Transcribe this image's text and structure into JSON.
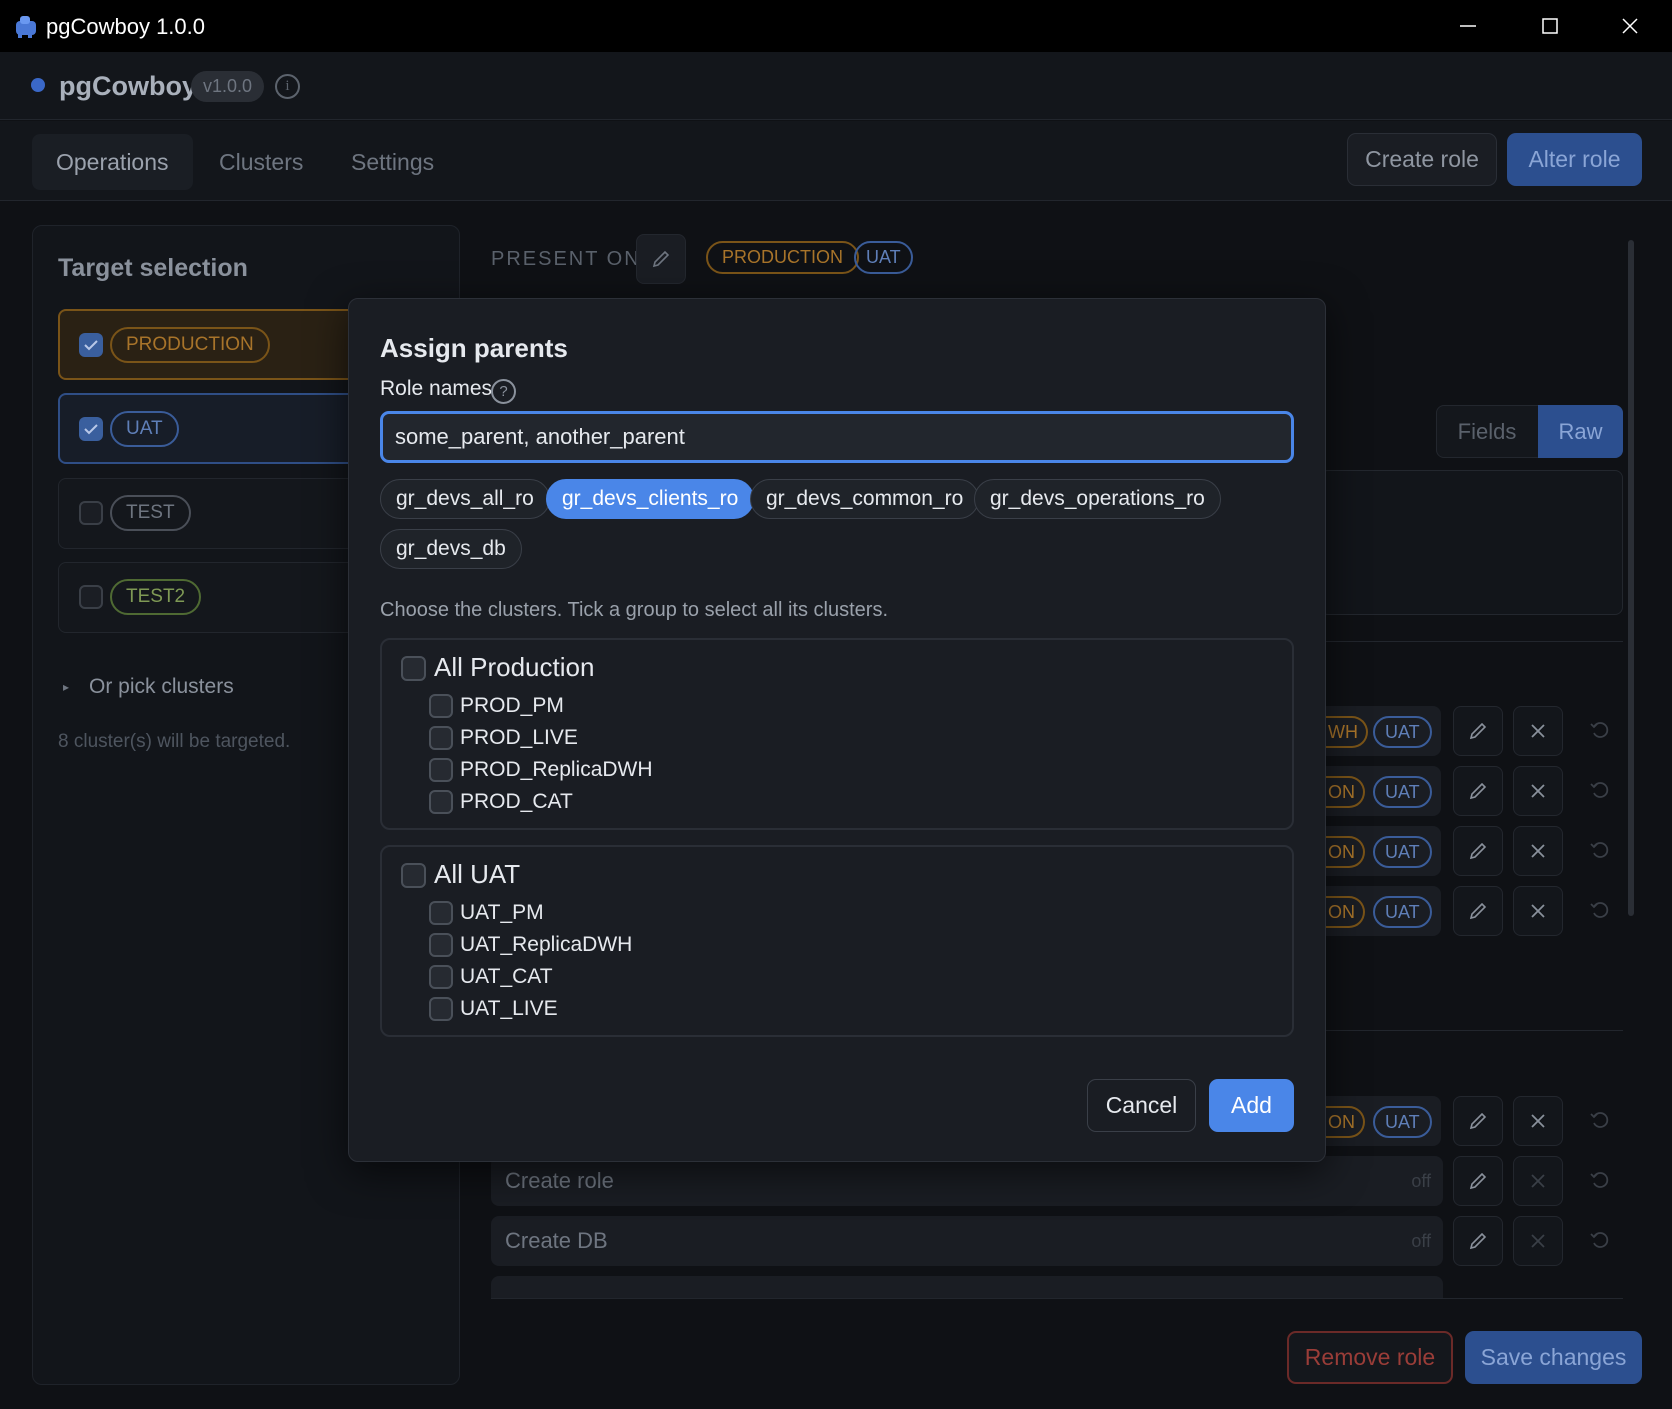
{
  "window": {
    "title": "pgCowboy 1.0.0"
  },
  "header": {
    "brand": "pgCowboy",
    "version": "v1.0.0"
  },
  "nav": {
    "tabs": [
      "Operations",
      "Clusters",
      "Settings"
    ],
    "create_role": "Create role",
    "alter_role": "Alter role"
  },
  "sidebar": {
    "title": "Target selection",
    "targets": [
      {
        "label": "PRODUCTION",
        "checked": true
      },
      {
        "label": "UAT",
        "checked": true
      },
      {
        "label": "TEST",
        "checked": false
      },
      {
        "label": "TEST2",
        "checked": false
      }
    ],
    "pick_clusters": "Or pick clusters",
    "summary": "8 cluster(s) will be targeted."
  },
  "main": {
    "present_on": "PRESENT ON",
    "badges": [
      "PRODUCTION",
      "UAT"
    ],
    "toggle": [
      "Fields",
      "Raw"
    ],
    "row_badges": [
      "WH",
      "UAT",
      "ON",
      "UAT",
      "ON",
      "UAT",
      "ON",
      "UAT",
      "ON",
      "UAT"
    ],
    "rows": [
      {
        "label": "Create role",
        "state": "off"
      },
      {
        "label": "Create DB",
        "state": "off"
      }
    ],
    "remove_role": "Remove role",
    "save_changes": "Save changes"
  },
  "modal": {
    "title": "Assign parents",
    "role_names_label": "Role names",
    "help_icon": "?",
    "input_value": "some_parent, another_parent",
    "suggestions": [
      {
        "label": "gr_devs_all_ro",
        "selected": false
      },
      {
        "label": "gr_devs_clients_ro",
        "selected": true
      },
      {
        "label": "gr_devs_common_ro",
        "selected": false
      },
      {
        "label": "gr_devs_operations_ro",
        "selected": false
      },
      {
        "label": "gr_devs_db",
        "selected": false
      }
    ],
    "hint": "Choose the clusters. Tick a group to select all its clusters.",
    "groups": [
      {
        "title": "All Production",
        "items": [
          "PROD_PM",
          "PROD_LIVE",
          "PROD_ReplicaDWH",
          "PROD_CAT"
        ]
      },
      {
        "title": "All UAT",
        "items": [
          "UAT_PM",
          "UAT_ReplicaDWH",
          "UAT_CAT",
          "UAT_LIVE"
        ]
      }
    ],
    "cancel": "Cancel",
    "add": "Add"
  },
  "colors": {
    "accent": "#4a86e8",
    "production": "#c98a2a",
    "uat": "#5b87d6",
    "test2": "#7fa34a",
    "danger": "#c0453f"
  }
}
